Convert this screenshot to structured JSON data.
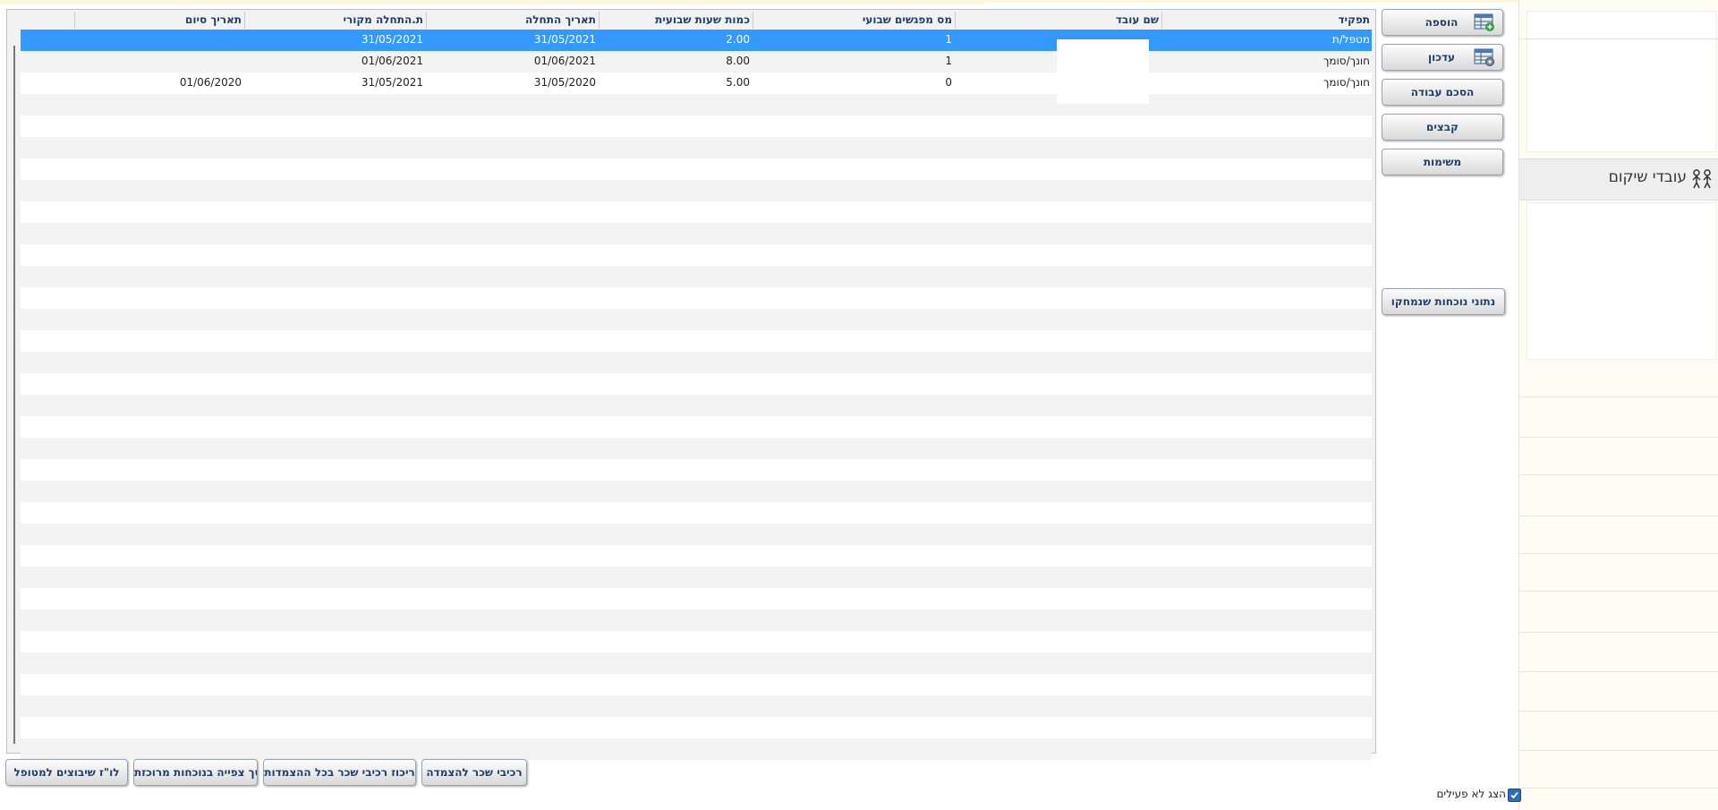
{
  "right_panel": {
    "title": "עובדי שיקום",
    "title_icon": "people-icon"
  },
  "side_buttons": {
    "add": {
      "label": "הוספה",
      "icon": "table-add-icon"
    },
    "update": {
      "label": "עדכון",
      "icon": "table-edit-icon"
    },
    "agreement": {
      "label": "הסכם עבודה"
    },
    "files": {
      "label": "קבצים"
    },
    "tasks": {
      "label": "משימות"
    },
    "deleted_attendance": {
      "label": "נתוני נוכחות שנמחקו"
    }
  },
  "table": {
    "columns": [
      "תפקיד",
      "שם עובד",
      "מס מפגשים שבועי",
      "כמות שעות שבועית",
      "תאריך התחלה",
      "ת.התחלה מקורי",
      "תאריך סיום"
    ],
    "rows": [
      {
        "role": "מטפל/ת",
        "name": "",
        "meetings": "1",
        "hours": "2.00",
        "start": "31/05/2021",
        "orig_start": "31/05/2021",
        "end": "",
        "selected": true
      },
      {
        "role": "חונך/סומך",
        "name": "",
        "meetings": "1",
        "hours": "8.00",
        "start": "01/06/2021",
        "orig_start": "01/06/2021",
        "end": "",
        "selected": false
      },
      {
        "role": "חונך/סומך",
        "name": "",
        "meetings": "0",
        "hours": "5.00",
        "start": "31/05/2020",
        "orig_start": "31/05/2021",
        "end": "01/06/2020",
        "selected": false
      }
    ]
  },
  "bottom_buttons": {
    "salary_components": "רכיבי שכר להצמדה",
    "salary_summary": "ריכוז רכיבי שכר בכל ההצמדות",
    "attendance_screen": "מסך צפייה בנוכחות מרוכזת",
    "schedule": "לו\"ז שיבוצים למטופל"
  },
  "show_inactive": {
    "label": "הצג לא פעילים",
    "checked": true
  },
  "colors": {
    "selected_row": "#3399ff",
    "header_text": "#1e3f66"
  }
}
